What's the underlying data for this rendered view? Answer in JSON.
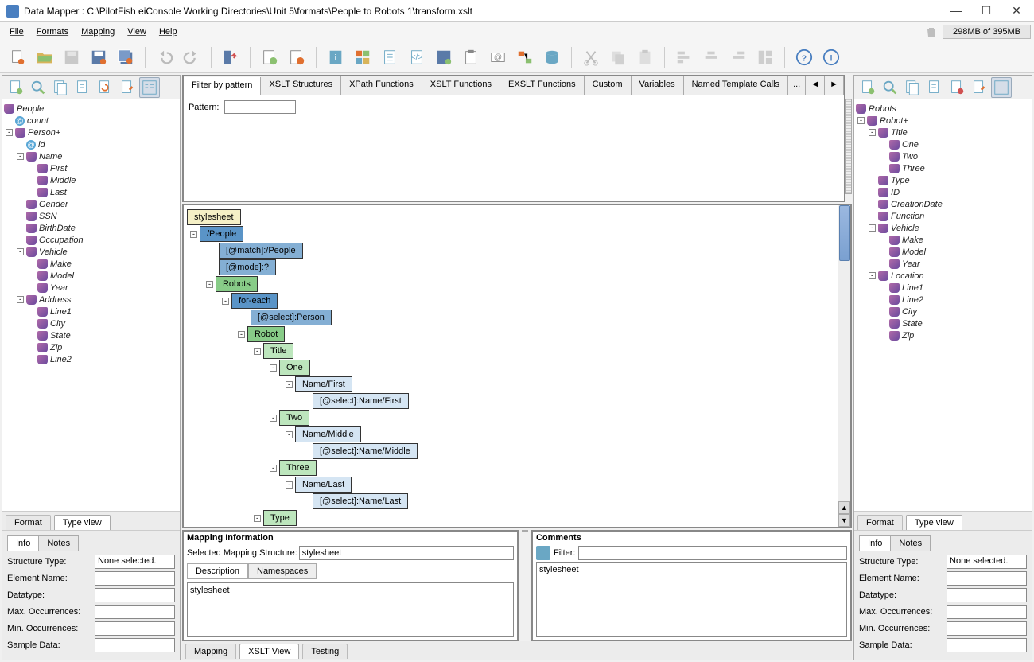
{
  "title": "Data Mapper : C:\\PilotFish eiConsole Working Directories\\Unit 5\\formats\\People to Robots 1\\transform.xslt",
  "menu": [
    "File",
    "Formats",
    "Mapping",
    "View",
    "Help"
  ],
  "memory": "298MB of 395MB",
  "left_tree_root": "People",
  "left_tree": {
    "count": "count",
    "person": "Person+",
    "id": "id",
    "name": "Name",
    "first": "First",
    "middle": "Middle",
    "last": "Last",
    "gender": "Gender",
    "ssn": "SSN",
    "birthdate": "BirthDate",
    "occupation": "Occupation",
    "vehicle": "Vehicle",
    "make": "Make",
    "model": "Model",
    "year": "Year",
    "address": "Address",
    "line1": "Line1",
    "city": "City",
    "state": "State",
    "zip": "Zip",
    "line2": "Line2"
  },
  "right_tree_root": "Robots",
  "right_tree": {
    "robot": "Robot+",
    "title": "Title",
    "one": "One",
    "two": "Two",
    "three": "Three",
    "type": "Type",
    "rid": "ID",
    "creation": "CreationDate",
    "function": "Function",
    "vehicle": "Vehicle",
    "make": "Make",
    "model": "Model",
    "year": "Year",
    "location": "Location",
    "line1": "Line1",
    "line2": "Line2",
    "city": "City",
    "state": "State",
    "zip": "Zip"
  },
  "center_tabs": [
    "Filter by pattern",
    "XSLT Structures",
    "XPath Functions",
    "XSLT Functions",
    "EXSLT Functions",
    "Custom",
    "Variables",
    "Named Template Calls"
  ],
  "center_tabs_more": "...",
  "pattern_label": "Pattern:",
  "xtree": {
    "stylesheet": "stylesheet",
    "people": "/People",
    "match": "[@match]:/People",
    "mode": "[@mode]:?",
    "robots": "Robots",
    "foreach": "for-each",
    "selPerson": "[@select]:Person",
    "robot": "Robot",
    "title": "Title",
    "one": "One",
    "nameFirst": "Name/First",
    "selFirst": "[@select]:Name/First",
    "two": "Two",
    "nameMiddle": "Name/Middle",
    "selMiddle": "[@select]:Name/Middle",
    "three": "Three",
    "nameLast": "Name/Last",
    "selLast": "[@select]:Name/Last",
    "type": "Type"
  },
  "map_info_title": "Mapping Information",
  "sel_struct_label": "Selected Mapping Structure:",
  "sel_struct_value": "stylesheet",
  "subtabs": [
    "Description",
    "Namespaces"
  ],
  "desc_text": "stylesheet",
  "comments_title": "Comments",
  "filter_label": "Filter:",
  "comment_text": "stylesheet",
  "bottom_view_tabs": [
    "Format",
    "Type view"
  ],
  "center_footer_tabs": [
    "Mapping",
    "XSLT View",
    "Testing"
  ],
  "info_tabs": [
    "Info",
    "Notes"
  ],
  "fields": {
    "struct_type": "Structure Type:",
    "struct_val": "None selected.",
    "elem_name": "Element Name:",
    "datatype": "Datatype:",
    "maxocc": "Max. Occurrences:",
    "minocc": "Min. Occurrences:",
    "sample": "Sample Data:"
  }
}
